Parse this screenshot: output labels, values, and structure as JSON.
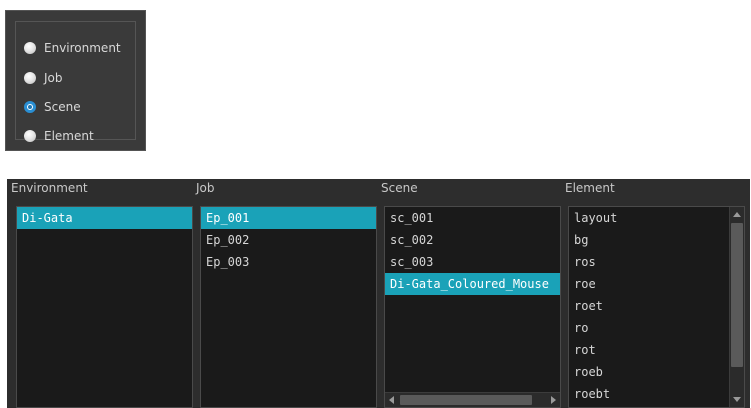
{
  "radio_group": {
    "options": [
      {
        "label": "Environment",
        "checked": false
      },
      {
        "label": "Job",
        "checked": false
      },
      {
        "label": "Scene",
        "checked": true
      },
      {
        "label": "Element",
        "checked": false
      }
    ]
  },
  "browser": {
    "columns": [
      {
        "header": "Environment",
        "items": [
          "Di-Gata"
        ],
        "selected_index": 0
      },
      {
        "header": "Job",
        "items": [
          "Ep_001",
          "Ep_002",
          "Ep_003"
        ],
        "selected_index": 0
      },
      {
        "header": "Scene",
        "items": [
          "sc_001",
          "sc_002",
          "sc_003",
          "Di-Gata_Coloured_Mouse"
        ],
        "selected_index": 3
      },
      {
        "header": "Element",
        "items": [
          "layout",
          "bg",
          "ros",
          "roe",
          "roet",
          "ro",
          "rot",
          "roeb",
          "roebt"
        ],
        "selected_index": -1
      }
    ]
  },
  "colors": {
    "selection": "#1aa2b8",
    "panel_background": "#2d2d2d",
    "list_background": "#1a1a1a",
    "radio_checked": "#2a8fd3"
  },
  "icons": {
    "scroll_up": "arrow-up-icon",
    "scroll_down": "arrow-down-icon",
    "scroll_left": "arrow-left-icon",
    "scroll_right": "arrow-right-icon"
  }
}
